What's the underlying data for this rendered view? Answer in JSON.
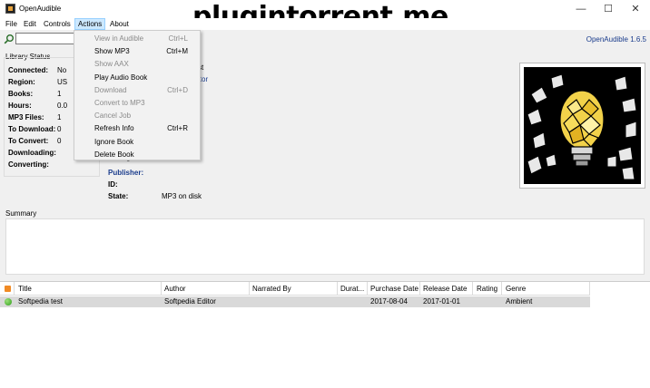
{
  "window": {
    "title": "OpenAudible",
    "watermark": "plugintorrent.me",
    "minimize_icon": "minimize-icon",
    "maximize_icon": "maximize-icon",
    "close_icon": "close-icon"
  },
  "menubar": {
    "items": [
      "File",
      "Edit",
      "Controls",
      "Actions",
      "About"
    ],
    "active": "Actions"
  },
  "actions_menu": [
    {
      "label": "View in Audible",
      "shortcut": "Ctrl+L",
      "enabled": false
    },
    {
      "label": "Show MP3",
      "shortcut": "Ctrl+M",
      "enabled": true
    },
    {
      "label": "Show AAX",
      "shortcut": "",
      "enabled": false
    },
    {
      "label": "Play Audio Book",
      "shortcut": "",
      "enabled": true
    },
    {
      "label": "Download",
      "shortcut": "Ctrl+D",
      "enabled": false
    },
    {
      "label": "Convert to MP3",
      "shortcut": "",
      "enabled": false
    },
    {
      "label": "Cancel Job",
      "shortcut": "",
      "enabled": false
    },
    {
      "label": "Refresh Info",
      "shortcut": "Ctrl+R",
      "enabled": true
    },
    {
      "label": "Ignore Book",
      "shortcut": "",
      "enabled": true
    },
    {
      "label": "Delete Book",
      "shortcut": "",
      "enabled": true
    }
  ],
  "toolbar": {
    "search_icon": "search-icon",
    "search_value": "",
    "version": "OpenAudible 1.6.5"
  },
  "library_status": {
    "title": "Library Status",
    "rows": [
      {
        "label": "Connected:",
        "value": "No"
      },
      {
        "label": "Region:",
        "value": "US"
      },
      {
        "label": "Books:",
        "value": "1"
      },
      {
        "label": "Hours:",
        "value": "0.0"
      },
      {
        "label": "MP3 Files:",
        "value": "1"
      },
      {
        "label": "To Download:",
        "value": "0"
      },
      {
        "label": "To Convert:",
        "value": "0"
      },
      {
        "label": "Downloading:",
        "value": ""
      },
      {
        "label": "Converting:",
        "value": ""
      }
    ]
  },
  "details": {
    "title_fragment": "st",
    "author_fragment": "itor",
    "rating_label_partial": "Rating:",
    "publisher_label": "Publisher:",
    "id_label": "ID:",
    "state_label": "State:",
    "state_value": "MP3 on disk"
  },
  "summary": {
    "label": "Summary"
  },
  "book_grid": {
    "header_icon": "rss-icon",
    "columns": [
      "Title",
      "Author",
      "Narrated By",
      "Durat...",
      "Purchase Date",
      "Release Date",
      "Rating",
      "Genre"
    ],
    "rows": [
      {
        "status_icon": "green-status-icon",
        "title": "Softpedia test",
        "author": "Softpedia Editor",
        "narrated_by": "",
        "duration": "",
        "purchase_date": "2017-08-04",
        "release_date": "2017-01-01",
        "rating": "",
        "genre": "Ambient"
      }
    ]
  },
  "colors": {
    "accent_blue": "#1a3c8c",
    "menu_highlight": "#cce8ff",
    "row_selected": "#d9d9d9"
  }
}
